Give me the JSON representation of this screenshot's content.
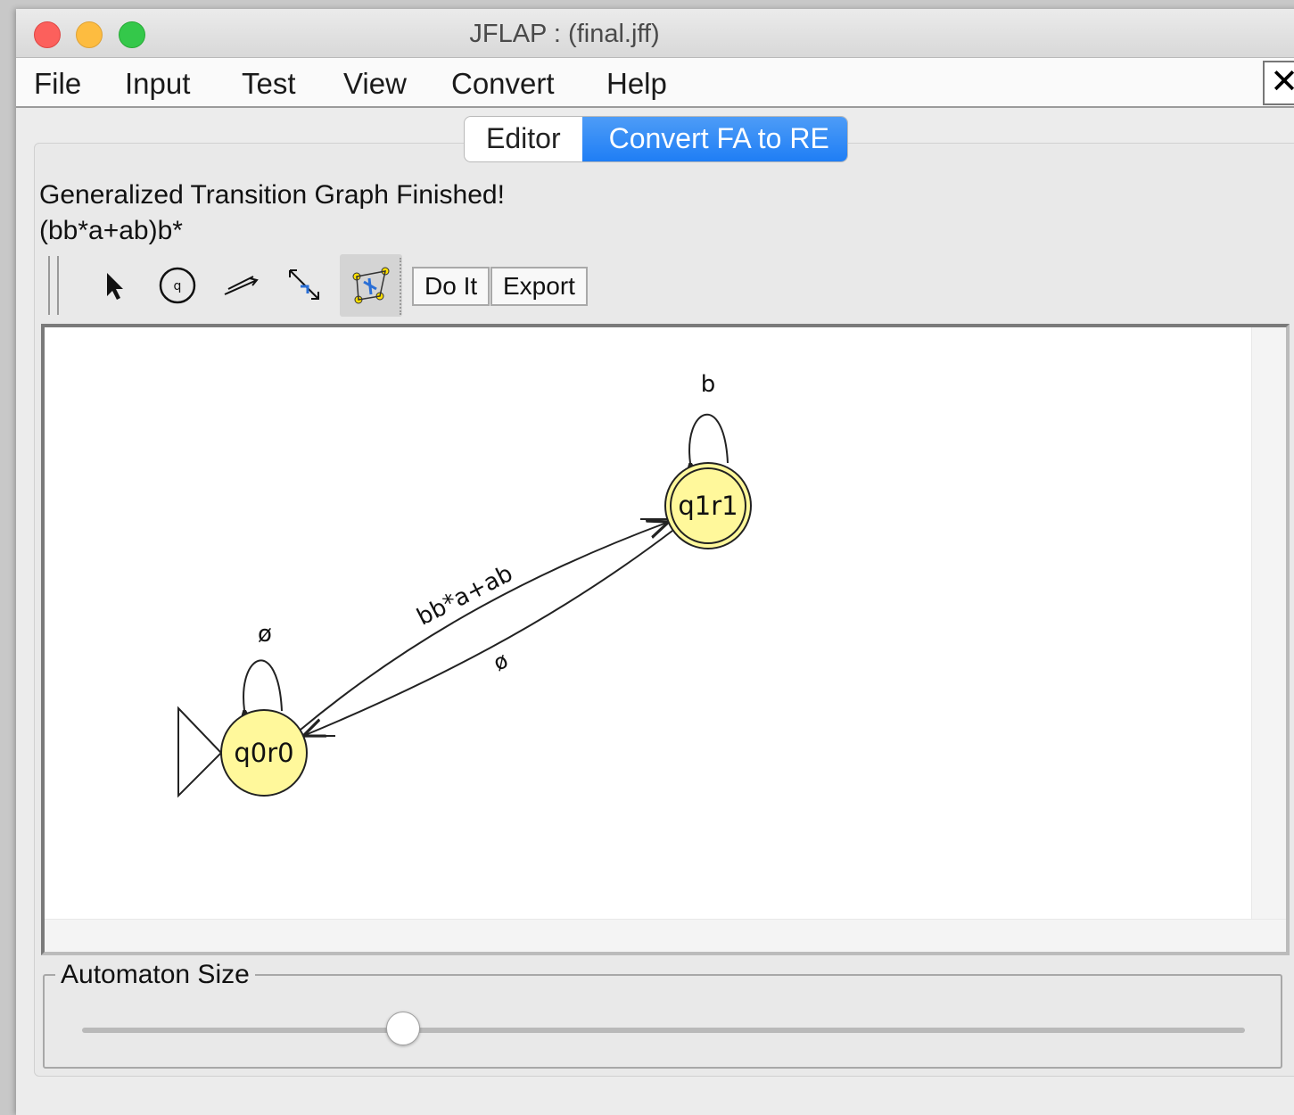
{
  "window": {
    "title": "JFLAP : (final.jff)"
  },
  "menu": {
    "items": [
      "File",
      "Input",
      "Test",
      "View",
      "Convert",
      "Help"
    ],
    "close": "✕"
  },
  "tabs": [
    {
      "label": "Editor",
      "active": false
    },
    {
      "label": "Convert FA to RE",
      "active": true
    }
  ],
  "status": {
    "message": "Generalized Transition Graph Finished!",
    "regex": "(bb*a+ab)b*"
  },
  "toolbar": {
    "tools": [
      "attribute-editor-icon",
      "state-creator-icon",
      "transition-creator-icon",
      "collapse-state-icon",
      "state-collapser-icon"
    ],
    "selected_tool": "state-collapser-icon",
    "do_it": "Do It",
    "export": "Export"
  },
  "automaton": {
    "states": [
      {
        "name": "q0r0",
        "initial": true,
        "final": false
      },
      {
        "name": "q1r1",
        "initial": false,
        "final": true
      }
    ],
    "transitions": [
      {
        "from": "q0r0",
        "to": "q1r1",
        "label": "bb*a+ab"
      },
      {
        "from": "q1r1",
        "to": "q0r0",
        "label": "ø"
      },
      {
        "from": "q0r0",
        "to": "q0r0",
        "label": "ø"
      },
      {
        "from": "q1r1",
        "to": "q1r1",
        "label": "b"
      }
    ],
    "state_color": "#fff89b"
  },
  "size_panel": {
    "label": "Automaton Size",
    "value_fraction": 0.275
  }
}
